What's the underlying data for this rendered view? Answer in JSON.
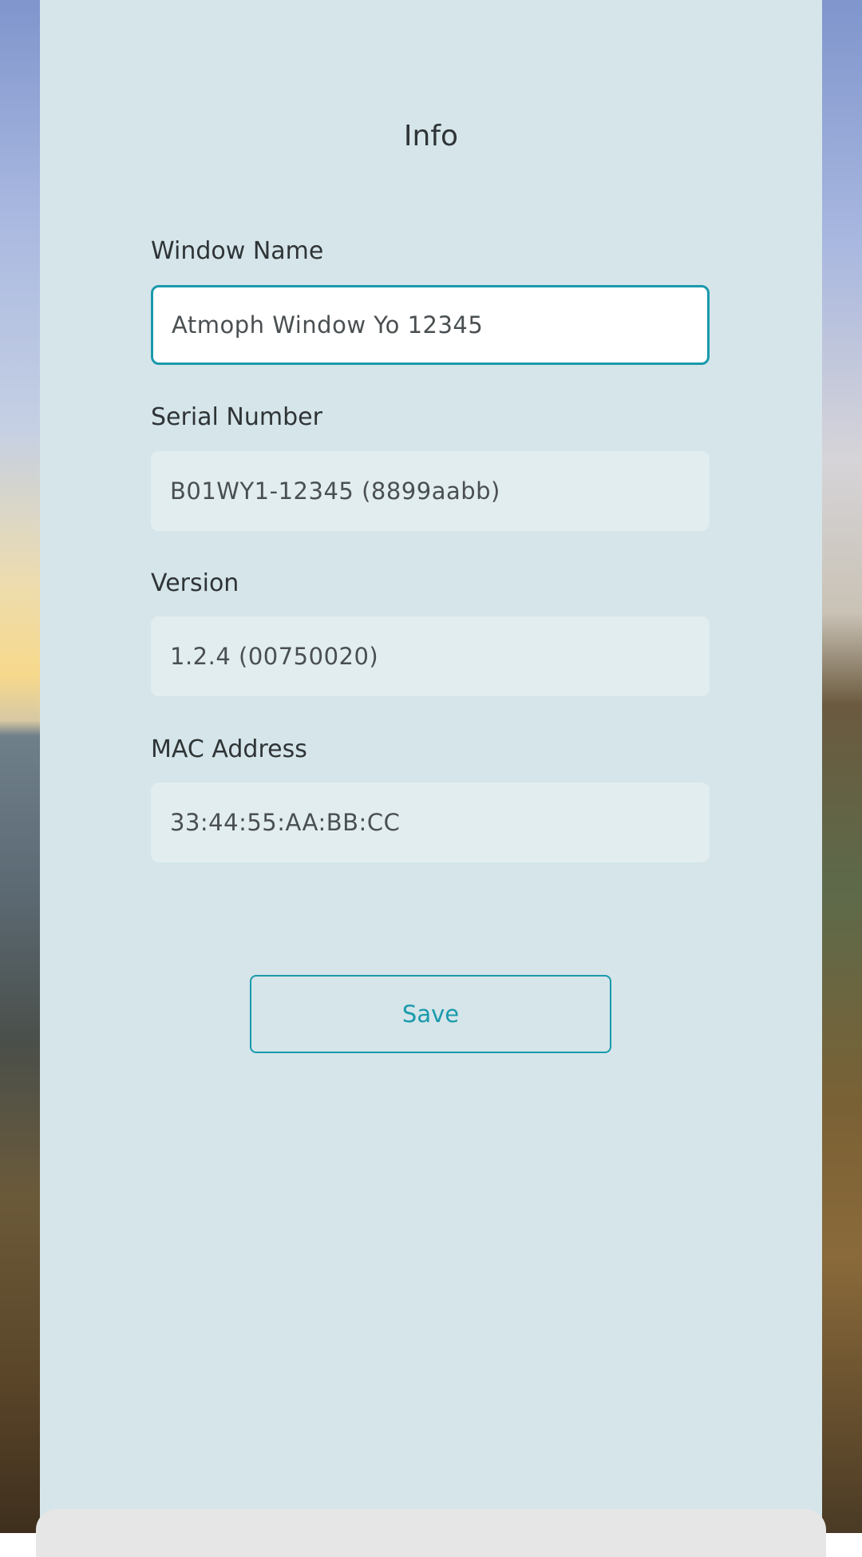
{
  "page": {
    "title": "Info"
  },
  "fields": {
    "window_name": {
      "label": "Window Name",
      "value": "Atmoph Window Yo 12345"
    },
    "serial_number": {
      "label": "Serial Number",
      "value": "B01WY1-12345 (8899aabb)"
    },
    "version": {
      "label": "Version",
      "value": "1.2.4 (00750020)"
    },
    "mac_address": {
      "label": "MAC Address",
      "value": "33:44:55:AA:BB:CC"
    }
  },
  "actions": {
    "save_label": "Save"
  },
  "colors": {
    "accent": "#1a9aad",
    "panel_bg": "#d5e5e9",
    "readonly_field_bg": "#e2edf0"
  }
}
